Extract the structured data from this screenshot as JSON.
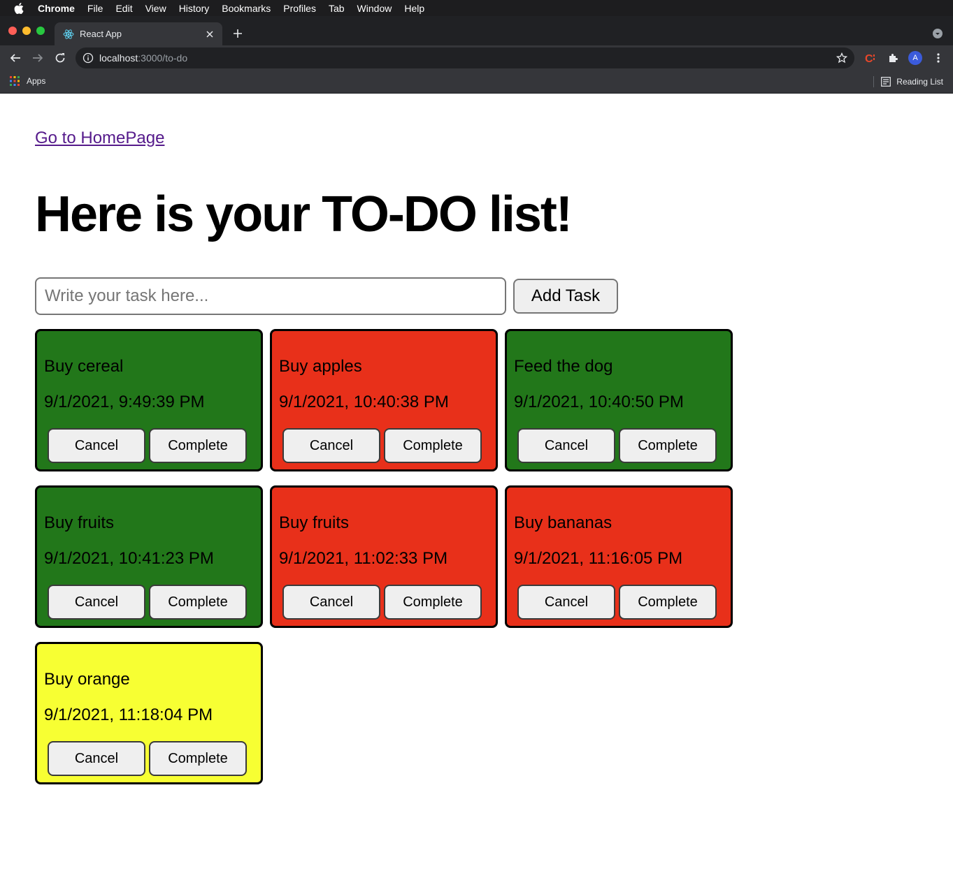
{
  "menubar": {
    "app": "Chrome",
    "items": [
      "File",
      "Edit",
      "View",
      "History",
      "Bookmarks",
      "Profiles",
      "Tab",
      "Window",
      "Help"
    ]
  },
  "browser": {
    "tab_title": "React App",
    "url_host": "localhost",
    "url_path": ":3000/to-do",
    "avatar_letter": "A",
    "bookmarks": {
      "apps_label": "Apps",
      "reading_list_label": "Reading List"
    }
  },
  "page": {
    "home_link": "Go to HomePage",
    "title": "Here is your TO-DO list!",
    "input_placeholder": "Write your task here...",
    "add_button": "Add Task"
  },
  "colors": {
    "green": "#22771a",
    "red": "#e8301a",
    "yellow": "#f7ff33"
  },
  "tasks": [
    {
      "name": "Buy cereal",
      "date": "9/1/2021, 9:49:39 PM",
      "color": "#22771a",
      "cancel": "Cancel",
      "complete": "Complete"
    },
    {
      "name": "Buy apples",
      "date": "9/1/2021, 10:40:38 PM",
      "color": "#e8301a",
      "cancel": "Cancel",
      "complete": "Complete"
    },
    {
      "name": "Feed the dog",
      "date": "9/1/2021, 10:40:50 PM",
      "color": "#22771a",
      "cancel": "Cancel",
      "complete": "Complete"
    },
    {
      "name": "Buy fruits",
      "date": "9/1/2021, 10:41:23 PM",
      "color": "#22771a",
      "cancel": "Cancel",
      "complete": "Complete"
    },
    {
      "name": "Buy fruits",
      "date": "9/1/2021, 11:02:33 PM",
      "color": "#e8301a",
      "cancel": "Cancel",
      "complete": "Complete"
    },
    {
      "name": "Buy bananas",
      "date": "9/1/2021, 11:16:05 PM",
      "color": "#e8301a",
      "cancel": "Cancel",
      "complete": "Complete"
    },
    {
      "name": "Buy orange",
      "date": "9/1/2021, 11:18:04 PM",
      "color": "#f7ff33",
      "cancel": "Cancel",
      "complete": "Complete"
    }
  ]
}
